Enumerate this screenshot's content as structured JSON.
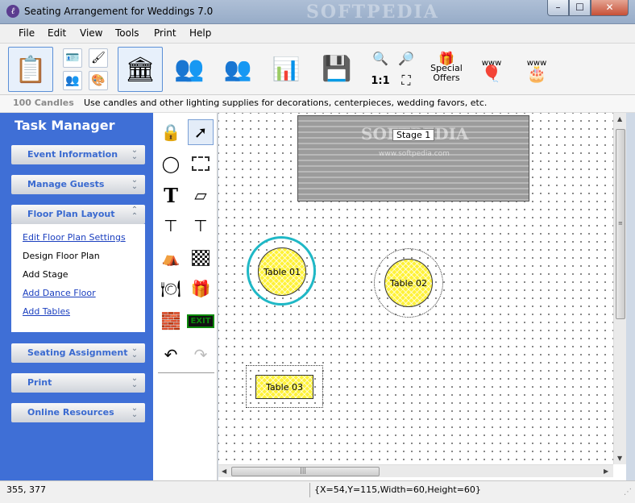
{
  "window": {
    "title": "Seating Arrangement for Weddings 7.0",
    "watermark": "SOFTPEDIA",
    "min": "–",
    "max": "☐",
    "close": "✕"
  },
  "menu": [
    "File",
    "Edit",
    "View",
    "Tools",
    "Print",
    "Help"
  ],
  "toolbar": {
    "special_offers_line1": "Special",
    "special_offers_line2": "Offers",
    "actual_size": "1:1",
    "www": "www"
  },
  "tip": {
    "heading": "100 Candles",
    "text": "Use candles and other lighting supplies for decorations, centerpieces, wedding favors, etc."
  },
  "task_manager": {
    "title": "Task Manager",
    "sections": [
      {
        "label": "Event Information",
        "expanded": false
      },
      {
        "label": "Manage Guests",
        "expanded": false
      },
      {
        "label": "Floor Plan Layout",
        "expanded": true
      },
      {
        "label": "Seating Assignment",
        "expanded": false
      },
      {
        "label": "Print",
        "expanded": false
      },
      {
        "label": "Online Resources",
        "expanded": false
      }
    ],
    "floor_plan_items": [
      {
        "label": "Edit Floor Plan Settings",
        "link": true
      },
      {
        "label": "Design Floor Plan",
        "link": false
      },
      {
        "label": "Add Stage",
        "link": false
      },
      {
        "label": "Add Dance Floor",
        "link": true
      },
      {
        "label": "Add Tables",
        "link": true
      }
    ]
  },
  "palette": {
    "text_tool": "T",
    "exit_sign": "EXIT",
    "dance_floor_num": "1"
  },
  "canvas": {
    "stage_label": "Stage 1",
    "stage_watermark": "SOFTPEDIA",
    "stage_watermark_url": "www.softpedia.com",
    "tables": [
      "Table 01",
      "Table 02",
      "Table 03"
    ]
  },
  "scroll": {
    "grip": "|||",
    "up": "▲",
    "down": "▼",
    "left": "◀",
    "right": "▶"
  },
  "status": {
    "cursor": "355, 377",
    "selection": "{X=54,Y=115,Width=60,Height=60}"
  }
}
